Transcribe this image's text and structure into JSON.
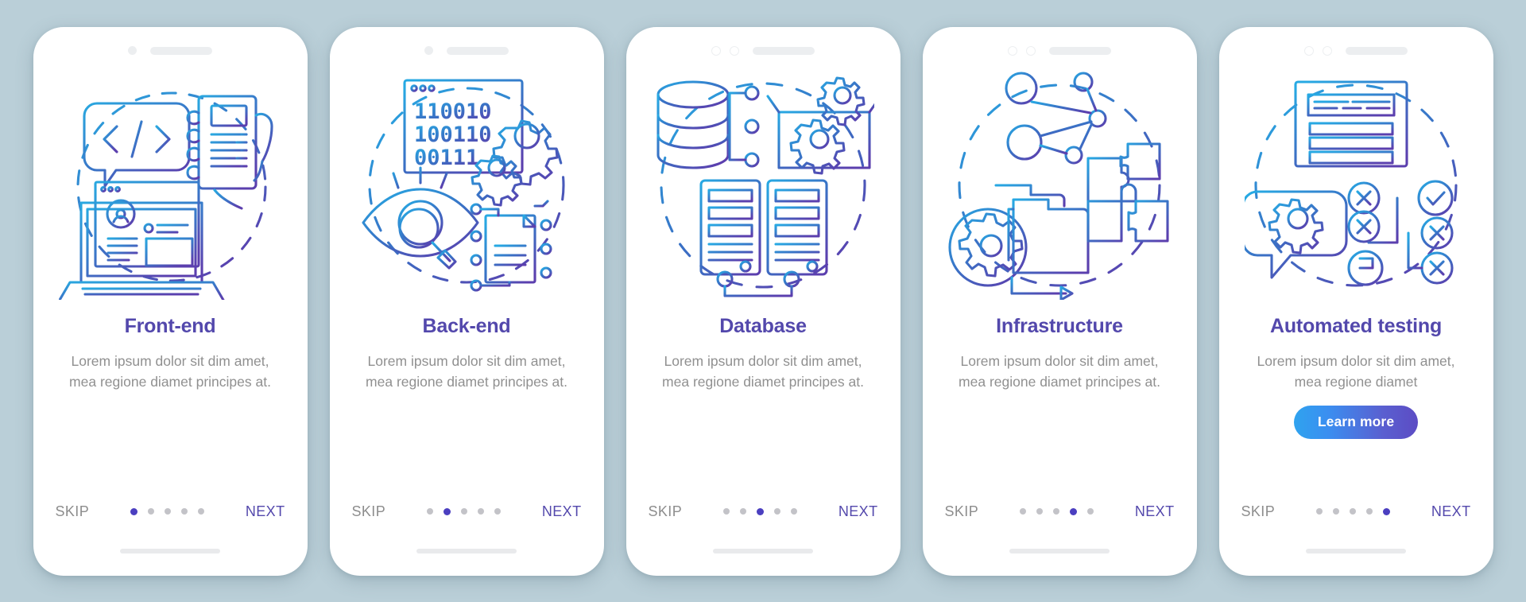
{
  "background_color": "#bacfd8",
  "accent_color": "#5348ac",
  "muted_text_color": "#909090",
  "dot_inactive_color": "#c3c3c8",
  "dot_active_color": "#4b3fc0",
  "nav": {
    "skip_label": "SKIP",
    "next_label": "NEXT",
    "total_dots": 5
  },
  "screens": [
    {
      "id": "front-end",
      "title": "Front-end",
      "description": "Lorem ipsum dolor sit dim amet, mea regione diamet principes at.",
      "active_dot": 1,
      "notch": "single-dot",
      "illustration": "front-end-illustration",
      "illustration_parts": [
        "code-bubble-icon",
        "hand-holding-phone-icon",
        "laptop-profile-icon",
        "dashed-circle"
      ],
      "has_learn_more": false,
      "learn_more_label": ""
    },
    {
      "id": "back-end",
      "title": "Back-end",
      "description": "Lorem ipsum dolor sit dim amet, mea regione diamet principes at.",
      "active_dot": 2,
      "notch": "single-dot",
      "illustration": "back-end-illustration",
      "illustration_parts": [
        "binary-window-icon",
        "gears-icon",
        "eye-magnifier-icon",
        "document-circuit-icon",
        "dashed-circle"
      ],
      "binary_lines": [
        "110010",
        "100110",
        "00111"
      ],
      "has_learn_more": false,
      "learn_more_label": ""
    },
    {
      "id": "database",
      "title": "Database",
      "description": "Lorem ipsum dolor sit dim amet, mea regione diamet principes at.",
      "active_dot": 3,
      "notch": "double-ring",
      "illustration": "database-illustration",
      "illustration_parts": [
        "database-cylinder-icon",
        "node-tree-icon",
        "gear-box-icon",
        "server-rack-icon",
        "dashed-circle"
      ],
      "has_learn_more": false,
      "learn_more_label": ""
    },
    {
      "id": "infrastructure",
      "title": "Infrastructure",
      "description": "Lorem ipsum dolor sit dim amet, mea regione diamet principes at.",
      "active_dot": 4,
      "notch": "double-ring",
      "illustration": "infrastructure-illustration",
      "illustration_parts": [
        "network-graph-icon",
        "gear-circle-icon",
        "folder-icon",
        "puzzle-pieces-icon",
        "arrow-icon",
        "dashed-circle"
      ],
      "has_learn_more": false,
      "learn_more_label": ""
    },
    {
      "id": "automated-testing",
      "title": "Automated testing",
      "description": "Lorem ipsum dolor sit dim amet, mea regione diamet",
      "active_dot": 5,
      "notch": "double-ring",
      "illustration": "automated-testing-illustration",
      "illustration_parts": [
        "document-window-icon",
        "speech-bubble-gear-icon",
        "x-circle-icon",
        "check-circle-icon",
        "flag-circle-icon",
        "dashed-circle"
      ],
      "has_learn_more": true,
      "learn_more_label": "Learn more"
    }
  ]
}
